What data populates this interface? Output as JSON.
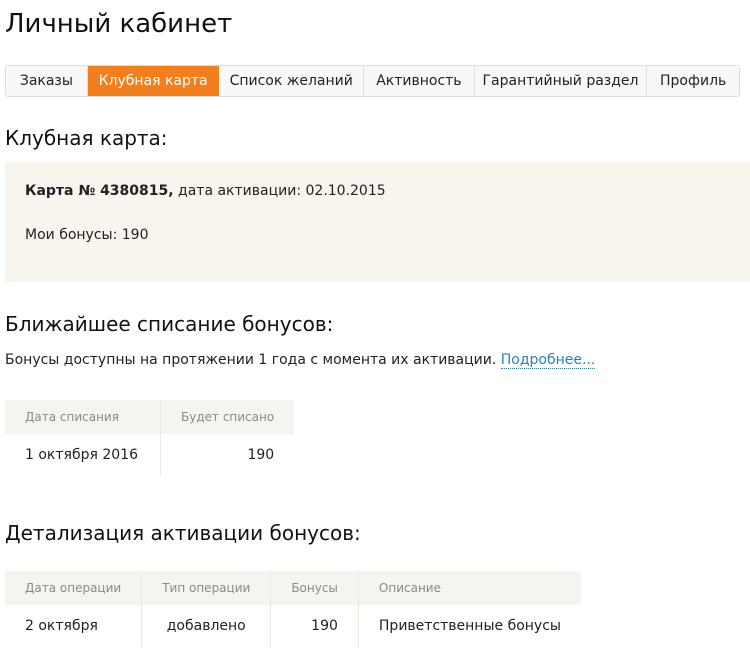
{
  "page": {
    "title": "Личный кабинет"
  },
  "tabs": [
    {
      "label": "Заказы",
      "active": false
    },
    {
      "label": "Клубная карта",
      "active": true
    },
    {
      "label": "Список желаний",
      "active": false
    },
    {
      "label": "Активность",
      "active": false
    },
    {
      "label": "Гарантийный раздел",
      "active": false
    },
    {
      "label": "Профиль",
      "active": false
    }
  ],
  "club_card": {
    "heading": "Клубная карта:",
    "card_label": "Карта № 4380815,",
    "activation_label": "дата активации:",
    "activation_date": "02.10.2015",
    "bonus_label": "Мои бонусы:",
    "bonus_value": "190"
  },
  "writeoff": {
    "heading": "Ближайшее списание бонусов:",
    "info": "Бонусы доступны на протяжении 1 года с момента их активации.",
    "more_link": "Подробнее...",
    "columns": [
      "Дата списания",
      "Будет списано"
    ],
    "rows": [
      [
        "1 октября 2016",
        "190"
      ]
    ]
  },
  "details": {
    "heading": "Детализация активации бонусов:",
    "columns": [
      "Дата операции",
      "Тип операции",
      "Бонусы",
      "Описание"
    ],
    "rows": [
      [
        "2 октября",
        "добавлено",
        "190",
        "Приветственные бонусы"
      ]
    ]
  },
  "colors": {
    "accent": "#f27f1c",
    "link": "#2d7fb8",
    "panel": "#f8f5ee"
  }
}
